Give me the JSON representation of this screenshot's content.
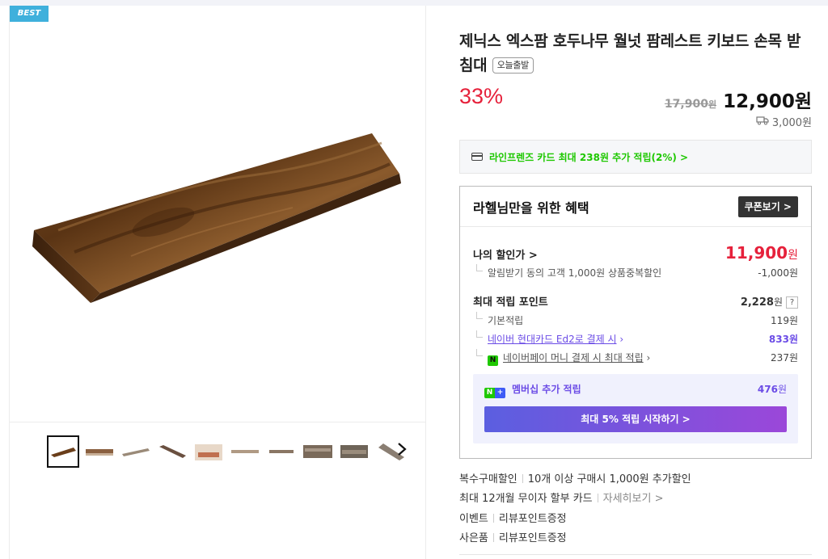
{
  "gallery": {
    "badge": "BEST",
    "next_icon": "chevron-right-icon"
  },
  "product": {
    "title": "제닉스 엑스팜 호두나무 월넛 팜레스트 키보드 손목 받침대",
    "delivery_badge": "오늘출발",
    "discount": "33%",
    "original_price": "17,900",
    "original_unit": "원",
    "price": "12,900원",
    "shipping": "3,000원"
  },
  "card_promo": {
    "text": "라인프렌즈 카드 최대 238원 추가 적립(2%) >"
  },
  "benefit": {
    "title": "라헬님만을 위한 혜택",
    "coupon_button": "쿠폰보기 >",
    "my_price_label": "나의 할인가 >",
    "my_price_value": "11,900",
    "my_price_unit": "원",
    "alarm_label": "알림받기 동의 고객 1,000원 상품중복할인",
    "alarm_value": "-1,000원",
    "max_points_label": "최대 적립 포인트",
    "max_points_value": "2,228",
    "max_points_unit": "원",
    "help": "?",
    "basic_label": "기본적립",
    "basic_value": "119원",
    "hyundai_label": "네이버 현대카드 Ed2로 결제 시",
    "hyundai_value": "833원",
    "npay_label": "네이버페이 머니 결제 시 최대 적립",
    "npay_value": "237원",
    "np_mark": "N",
    "member_n": "N",
    "member_plus": "+",
    "member_label": "멤버십 추가 적립",
    "member_value": "476",
    "member_unit": "원",
    "start_button": "최대 5% 적립 시작하기 >"
  },
  "extras": {
    "multi_label": "복수구매할인",
    "multi_text": "10개 이상 구매시 1,000원 추가할인",
    "installment_text": "최대 12개월 무이자 할부 카드",
    "installment_link": "자세히보기 >",
    "event_label": "이벤트",
    "event_text": "리뷰포인트증정",
    "gift_label": "사은품",
    "gift_text": "리뷰포인트증정"
  },
  "colors": {
    "discount_red": "#e6213b",
    "naver_green": "#1ec800",
    "purple": "#6b4ce6",
    "best_blue": "#3fb0dc"
  }
}
